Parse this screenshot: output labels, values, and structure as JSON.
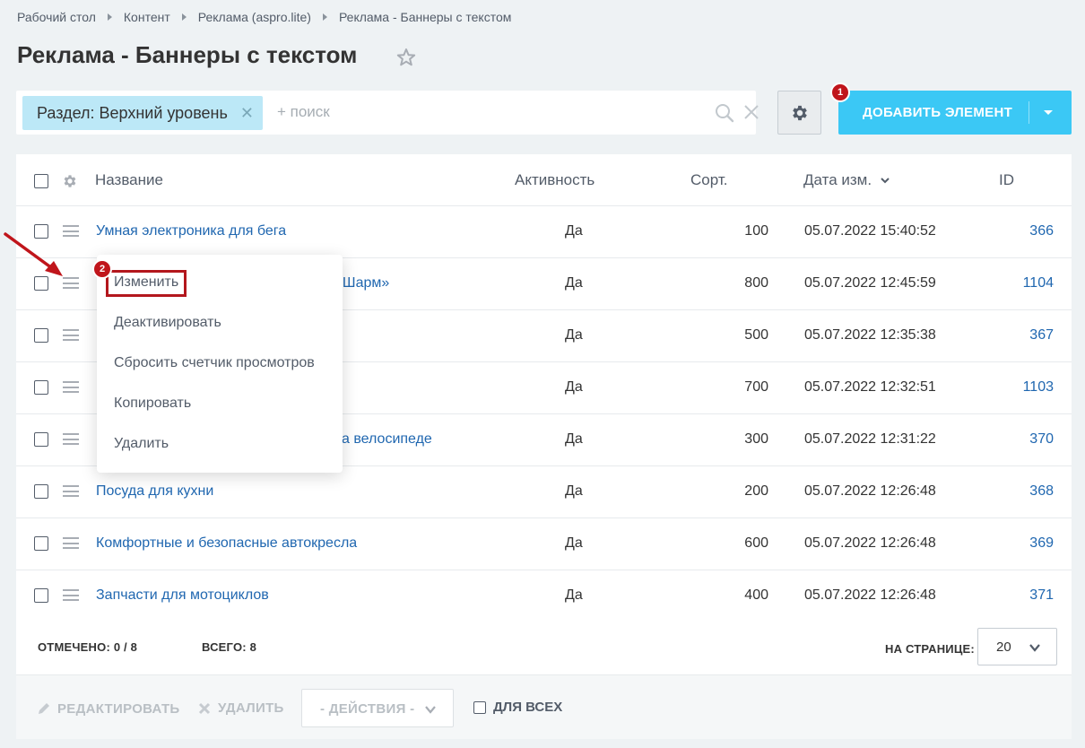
{
  "breadcrumb": [
    "Рабочий стол",
    "Контент",
    "Реклама (aspro.lite)",
    "Реклама - Баннеры с текстом"
  ],
  "title": "Реклама - Баннеры с текстом",
  "filter": {
    "tag": "Раздел: Верхний уровень",
    "search_placeholder": "+ поиск"
  },
  "add_button": {
    "label": "ДОБАВИТЬ ЭЛЕМЕНТ",
    "color": "#3bc8f5"
  },
  "badges": {
    "first": "1",
    "second": "2"
  },
  "columns": {
    "name": "Название",
    "active": "Активность",
    "sort": "Сорт.",
    "date": "Дата изм.",
    "id": "ID"
  },
  "rows": [
    {
      "name": "Умная электроника для бега",
      "active": "Да",
      "sort": "100",
      "date": "05.07.2022 15:40:52",
      "id": "366"
    },
    {
      "name": "«Шарм»",
      "active": "Да",
      "sort": "800",
      "date": "05.07.2022 12:45:59",
      "id": "1104"
    },
    {
      "name": "",
      "active": "Да",
      "sort": "500",
      "date": "05.07.2022 12:35:38",
      "id": "367"
    },
    {
      "name": "",
      "active": "Да",
      "sort": "700",
      "date": "05.07.2022 12:32:51",
      "id": "1103"
    },
    {
      "name": "а велосипеде",
      "active": "Да",
      "sort": "300",
      "date": "05.07.2022 12:31:22",
      "id": "370"
    },
    {
      "name": "Посуда для кухни",
      "active": "Да",
      "sort": "200",
      "date": "05.07.2022 12:26:48",
      "id": "368"
    },
    {
      "name": "Комфортные и безопасные автокресла",
      "active": "Да",
      "sort": "600",
      "date": "05.07.2022 12:26:48",
      "id": "369"
    },
    {
      "name": "Запчасти для мотоциклов",
      "active": "Да",
      "sort": "400",
      "date": "05.07.2022 12:26:48",
      "id": "371"
    }
  ],
  "context_menu": [
    "Изменить",
    "Деактивировать",
    "Сбросить счетчик просмотров",
    "Копировать",
    "Удалить"
  ],
  "footer": {
    "checked_label": "ОТМЕЧЕНО:",
    "checked_value": "0 / 8",
    "total_label": "ВСЕГО:",
    "total_value": "8",
    "per_page_label": "НА СТРАНИЦЕ:",
    "per_page_value": "20"
  },
  "actions": {
    "edit": "РЕДАКТИРОВАТЬ",
    "delete": "УДАЛИТЬ",
    "select": "- ДЕЙСТВИЯ -",
    "for_all": "ДЛЯ ВСЕХ"
  },
  "colors": {
    "accent": "#3bc8f5",
    "link": "#2067b0",
    "badge": "#c0151b",
    "background": "#eef2f4"
  }
}
